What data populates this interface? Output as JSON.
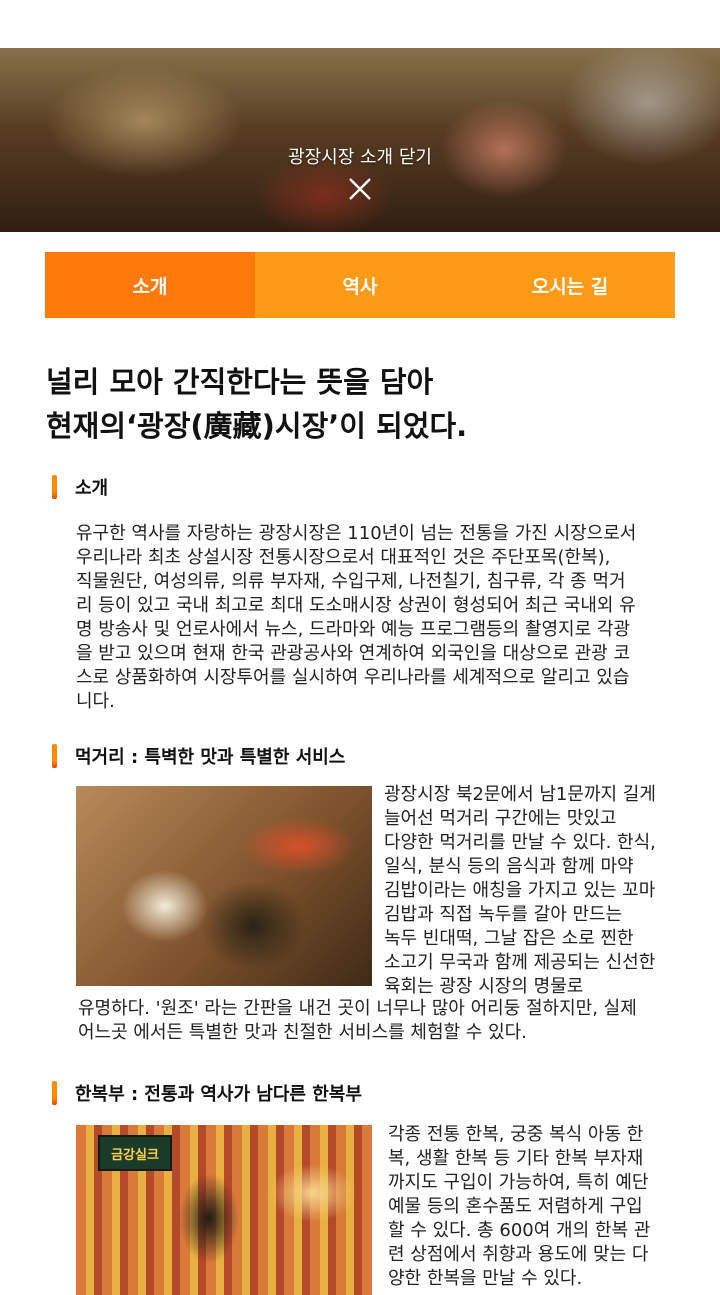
{
  "hero": {
    "close_label": "광장시장 소개 닫기",
    "close_icon": "close-icon"
  },
  "tabs": [
    {
      "label": "소개",
      "active": true
    },
    {
      "label": "역사",
      "active": false
    },
    {
      "label": "오시는 길",
      "active": false
    }
  ],
  "headline": {
    "line1": "널리 모아 간직한다는 뜻을 담아",
    "line2": "현재의‘광장(廣藏)시장’이 되었다."
  },
  "sections": {
    "intro": {
      "title": "소개",
      "lines": [
        "유구한 역사를 자랑하는 광장시장은 110년이 넘는 전통을 가진 시장으로서",
        "우리나라 최초 상설시장 전통시장으로서 대표적인 것은 주단포목(한복),",
        "직물원단, 여성의류, 의류 부자재, 수입구제, 나전칠기, 침구류, 각 종 먹거",
        "리 등이 있고 국내 최고로 최대 도소매시장 상권이 형성되어 최근 국내외 유",
        "명 방송사 및 언로사에서 뉴스, 드라마와 예능 프로그램등의 촬영지로 각광",
        "을 받고 있으며 현재 한국 관광공사와 연계하여 외국인을 대상으로 관광 코",
        "스로 상품화하여 시장투어를 실시하여 우리나라를 세계적으로 알리고 있습",
        "니다."
      ]
    },
    "food": {
      "title": "먹거리 : 특벽한 맛과 특별한 서비스",
      "side_lines": [
        "광장시장 북2문에서 남1문까지 길게",
        "늘어선 먹거리 구간에는 맛있고",
        "다양한 먹거리를 만날 수 있다. 한식,",
        "일식, 분식 등의 음식과 함께 마약",
        "김밥이라는 애칭을 가지고 있는 꼬마",
        "김밥과 직접 녹두를 갈아 만드는",
        "녹두 빈대떡, 그날 잡은 소로 찐한",
        "소고기 무국과 함께 제공되는 신선한",
        "육회는 광장 시장의 명물로"
      ],
      "full_lines": [
        "유명하다. '원조' 라는 간판을 내건 곳이 너무나 많아 어리둥 절하지만, 실제",
        "어느곳 에서든 특별한 맛과 친절한 서비스를 체험할 수 있다."
      ]
    },
    "hanbok": {
      "title": "한복부 : 전통과 역사가 남다른 한복부",
      "sign_text": "금강실크",
      "side_lines": [
        "각종 전통 한복, 궁중 복식 아동 한",
        "복, 생활 한복 등 기타 한복 부자재",
        "까지도 구입이 가능하여, 특히 예단",
        "예물 등의 혼수품도 저렴하게 구입",
        "할 수 있다. 총 600여 개의 한복 관",
        "련 상점에서 취향과 용도에 맞는 다",
        "양한 한복을 만날 수 있다."
      ]
    }
  },
  "colors": {
    "tab_bg": "#ff9a16",
    "tab_active_bg": "#ff7a0a",
    "accent_bar": "#ff8a00"
  }
}
